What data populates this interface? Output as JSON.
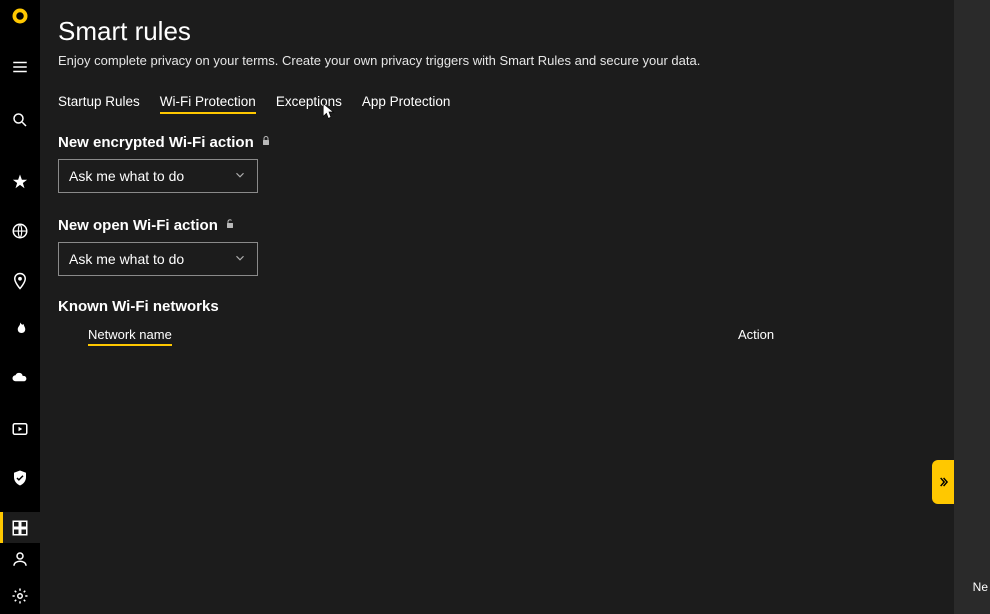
{
  "header": {
    "title": "Smart rules",
    "subtitle": "Enjoy complete privacy on your terms. Create your own privacy triggers with Smart Rules and secure your data."
  },
  "tabs": {
    "startup": "Startup Rules",
    "wifi": "Wi-Fi Protection",
    "exceptions": "Exceptions",
    "app": "App Protection"
  },
  "wifi": {
    "encrypted_label": "New encrypted Wi-Fi action",
    "encrypted_value": "Ask me what to do",
    "open_label": "New open Wi-Fi action",
    "open_value": "Ask me what to do",
    "known_label": "Known Wi-Fi networks",
    "col_network": "Network name",
    "col_action": "Action"
  },
  "rightstrip": {
    "text": "Ne"
  }
}
